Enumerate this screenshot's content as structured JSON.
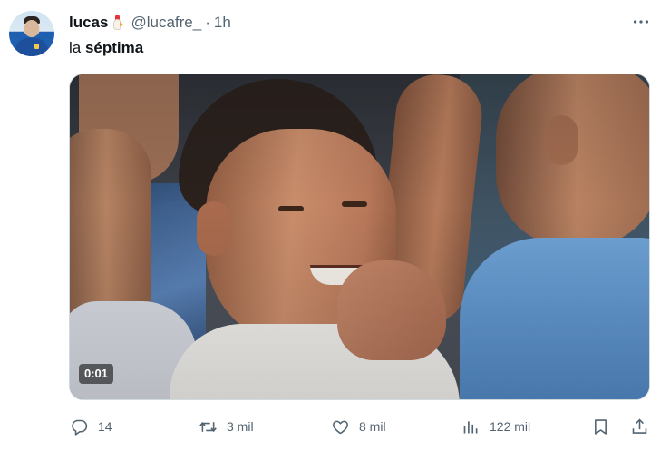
{
  "author": {
    "display_name": "lucas",
    "name_emoji_icon": "rooster-icon",
    "handle": "@lucafre_",
    "separator": "·",
    "time": "1h"
  },
  "tweet": {
    "text_plain": "la ",
    "text_bold": "séptima"
  },
  "media": {
    "type": "video",
    "duration_label": "0:01"
  },
  "actions": {
    "reply_count": "14",
    "retweet_count": "3 mil",
    "like_count": "8 mil",
    "view_count": "122 mil"
  },
  "icons": {
    "more": "more-horizontal-icon",
    "reply": "reply-icon",
    "retweet": "retweet-icon",
    "like": "heart-icon",
    "views": "views-chart-icon",
    "bookmark": "bookmark-icon",
    "share": "share-icon"
  },
  "colors": {
    "text_primary": "#0f1419",
    "text_secondary": "#536471",
    "border": "#cfd9de"
  }
}
